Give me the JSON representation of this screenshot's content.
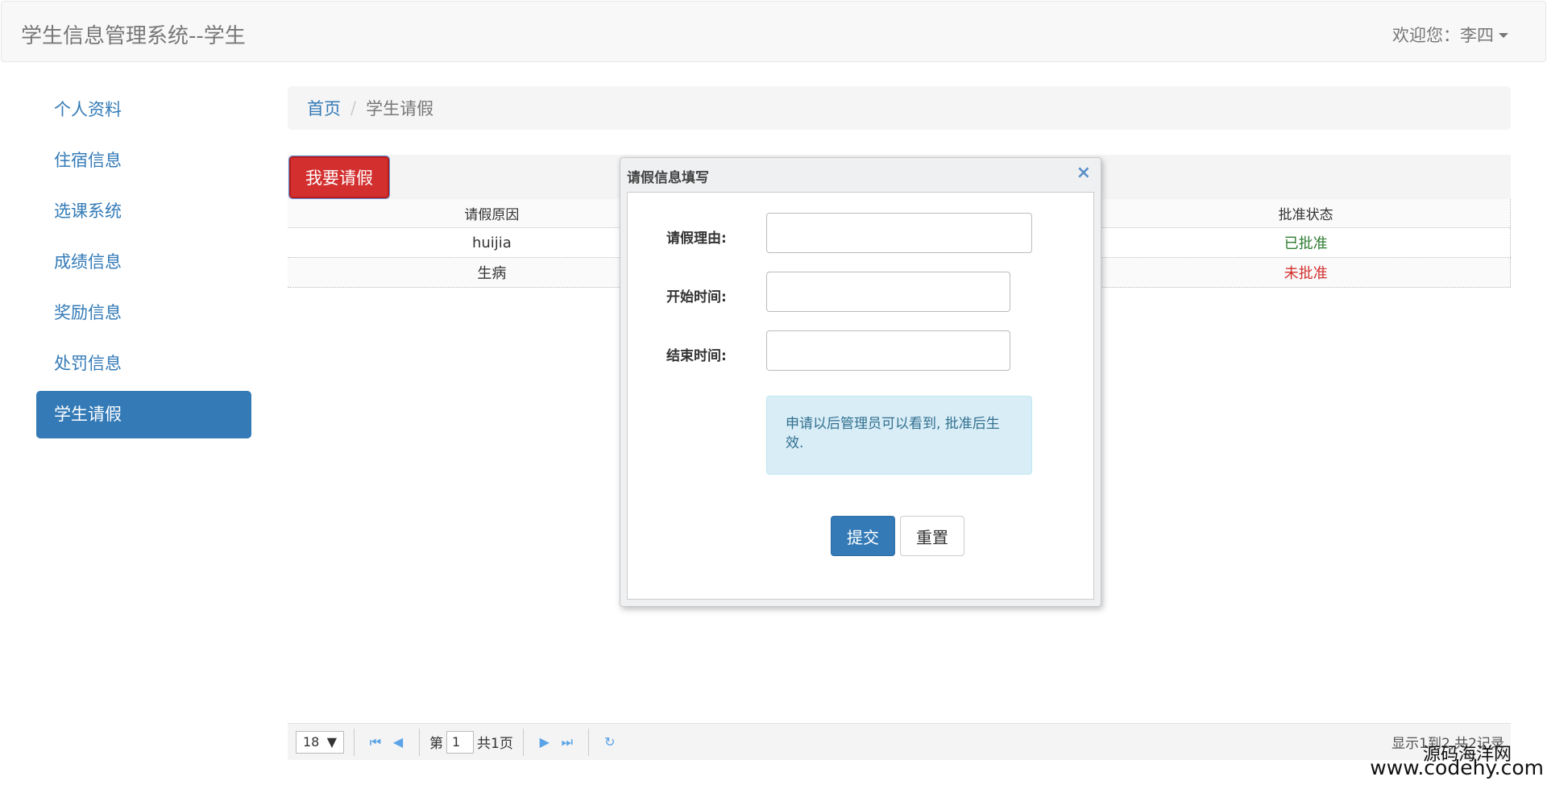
{
  "navbar": {
    "brand": "学生信息管理系统--学生",
    "welcome": "欢迎您：李四"
  },
  "sidebar": {
    "items": [
      {
        "label": "个人资料",
        "active": false
      },
      {
        "label": "住宿信息",
        "active": false
      },
      {
        "label": "选课系统",
        "active": false
      },
      {
        "label": "成绩信息",
        "active": false
      },
      {
        "label": "奖励信息",
        "active": false
      },
      {
        "label": "处罚信息",
        "active": false
      },
      {
        "label": "学生请假",
        "active": true
      }
    ]
  },
  "breadcrumb": {
    "home": "首页",
    "separator": "/",
    "current": "学生请假"
  },
  "toolbar": {
    "leave_button": "我要请假"
  },
  "grid": {
    "columns": [
      "请假原因",
      "批准状态"
    ],
    "rows": [
      {
        "reason": "huijia",
        "status": "已批准",
        "status_color": "#2e7d32"
      },
      {
        "reason": "生病",
        "status": "未批准",
        "status_color": "#d32f2f"
      }
    ]
  },
  "pager": {
    "page_size": "18",
    "page_prefix": "第",
    "page_number": "1",
    "page_total": "共1页",
    "summary": "显示1到2,共2记录"
  },
  "dialog": {
    "title": "请假信息填写",
    "close": "×",
    "fields": {
      "reason_label": "请假理由:",
      "start_label": "开始时间:",
      "end_label": "结束时间:"
    },
    "note": "申请以后管理员可以看到, 批准后生效.",
    "submit": "提交",
    "reset": "重置"
  },
  "watermark": {
    "line1": "源码海洋网",
    "line2": "www.codehy.com"
  }
}
